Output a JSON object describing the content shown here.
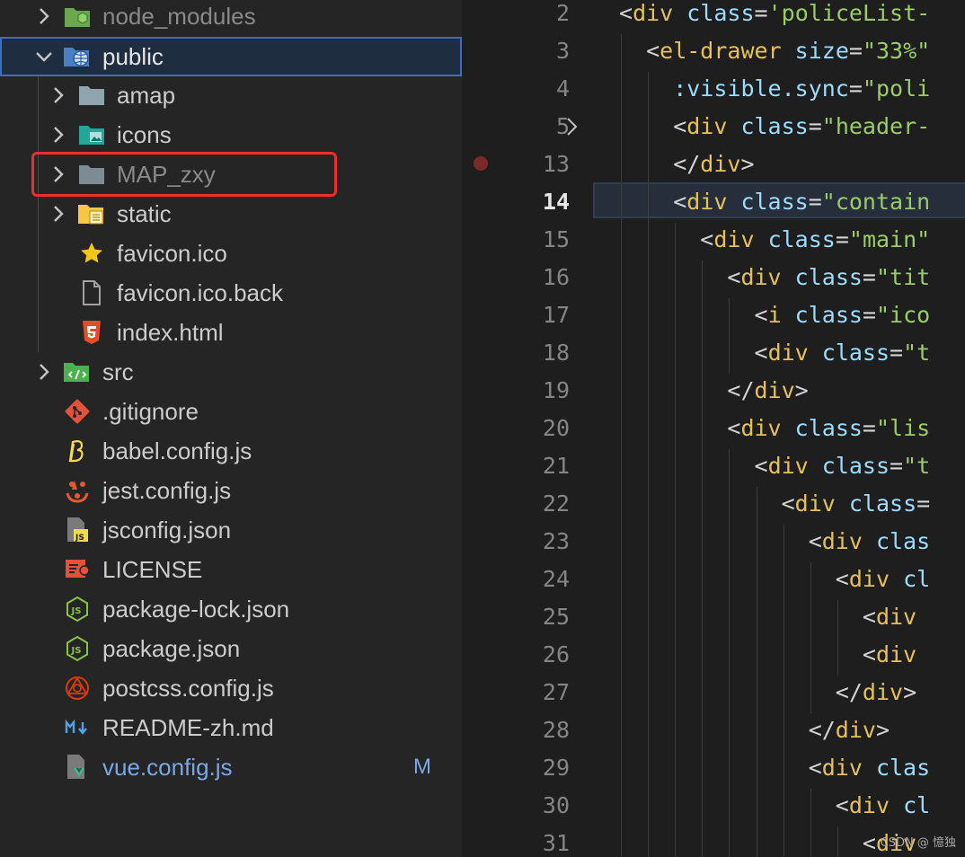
{
  "explorer": {
    "items": [
      {
        "label": "node_modules",
        "icon": "node-modules-folder-icon",
        "expanded": false
      },
      {
        "label": "public",
        "icon": "public-folder-icon",
        "expanded": true,
        "selected": true
      },
      {
        "label": "amap",
        "icon": "folder-icon",
        "expanded": false
      },
      {
        "label": "icons",
        "icon": "images-folder-icon",
        "expanded": false
      },
      {
        "label": "MAP_zxy",
        "icon": "folder-icon",
        "expanded": false,
        "highlighted": true
      },
      {
        "label": "static",
        "icon": "static-folder-icon",
        "expanded": false
      },
      {
        "label": "favicon.ico",
        "icon": "star-icon"
      },
      {
        "label": "favicon.ico.back",
        "icon": "file-icon"
      },
      {
        "label": "index.html",
        "icon": "html5-icon"
      },
      {
        "label": "src",
        "icon": "src-folder-icon",
        "expanded": false
      },
      {
        "label": ".gitignore",
        "icon": "git-icon"
      },
      {
        "label": "babel.config.js",
        "icon": "babel-icon"
      },
      {
        "label": "jest.config.js",
        "icon": "jest-icon"
      },
      {
        "label": "jsconfig.json",
        "icon": "jsconfig-icon"
      },
      {
        "label": "LICENSE",
        "icon": "license-icon"
      },
      {
        "label": "package-lock.json",
        "icon": "nodejs-icon"
      },
      {
        "label": "package.json",
        "icon": "nodejs-icon"
      },
      {
        "label": "postcss.config.js",
        "icon": "postcss-icon"
      },
      {
        "label": "README-zh.md",
        "icon": "markdown-icon"
      },
      {
        "label": "vue.config.js",
        "icon": "vue-config-icon",
        "badge": "M"
      }
    ]
  },
  "editor": {
    "active_line": "14",
    "lines": [
      {
        "n": "2",
        "t": [
          [
            "<",
            "b"
          ],
          [
            "div",
            "tag"
          ],
          [
            " class",
            "attr"
          ],
          [
            "=",
            "p"
          ],
          [
            "'policeList-",
            "str"
          ]
        ]
      },
      {
        "n": "3",
        "t": [
          [
            "<",
            "b"
          ],
          [
            "el-drawer",
            "tag"
          ],
          [
            " size",
            "attr"
          ],
          [
            "=",
            "p"
          ],
          [
            "\"33%\"",
            "str"
          ]
        ]
      },
      {
        "n": "4",
        "t": [
          [
            ":visible.sync",
            "attr"
          ],
          [
            "=",
            "p"
          ],
          [
            "\"poli",
            "str"
          ]
        ]
      },
      {
        "n": "5",
        "t": [
          [
            "<",
            "b"
          ],
          [
            "div",
            "tag"
          ],
          [
            " class",
            "attr"
          ],
          [
            "=",
            "p"
          ],
          [
            "\"header-",
            "str"
          ]
        ]
      },
      {
        "n": "13",
        "t": [
          [
            "</",
            "b"
          ],
          [
            "div",
            "tag"
          ],
          [
            ">",
            "b"
          ]
        ]
      },
      {
        "n": "14",
        "t": [
          [
            "<",
            "b"
          ],
          [
            "div",
            "tag"
          ],
          [
            " class",
            "attr"
          ],
          [
            "=",
            "p"
          ],
          [
            "\"contain",
            "str"
          ]
        ]
      },
      {
        "n": "15",
        "t": [
          [
            "<",
            "b"
          ],
          [
            "div",
            "tag"
          ],
          [
            " class",
            "attr"
          ],
          [
            "=",
            "p"
          ],
          [
            "\"main\"",
            "str"
          ]
        ]
      },
      {
        "n": "16",
        "t": [
          [
            "<",
            "b"
          ],
          [
            "div",
            "tag"
          ],
          [
            " class",
            "attr"
          ],
          [
            "=",
            "p"
          ],
          [
            "\"tit",
            "str"
          ]
        ]
      },
      {
        "n": "17",
        "t": [
          [
            "<",
            "b"
          ],
          [
            "i",
            "tag"
          ],
          [
            " class",
            "attr"
          ],
          [
            "=",
            "p"
          ],
          [
            "\"ico",
            "str"
          ]
        ]
      },
      {
        "n": "18",
        "t": [
          [
            "<",
            "b"
          ],
          [
            "div",
            "tag"
          ],
          [
            " class",
            "attr"
          ],
          [
            "=",
            "p"
          ],
          [
            "\"t",
            "str"
          ]
        ]
      },
      {
        "n": "19",
        "t": [
          [
            "</",
            "b"
          ],
          [
            "div",
            "tag"
          ],
          [
            ">",
            "b"
          ]
        ]
      },
      {
        "n": "20",
        "t": [
          [
            "<",
            "b"
          ],
          [
            "div",
            "tag"
          ],
          [
            " class",
            "attr"
          ],
          [
            "=",
            "p"
          ],
          [
            "\"lis",
            "str"
          ]
        ]
      },
      {
        "n": "21",
        "t": [
          [
            "<",
            "b"
          ],
          [
            "div",
            "tag"
          ],
          [
            " class",
            "attr"
          ],
          [
            "=",
            "p"
          ],
          [
            "\"t",
            "str"
          ]
        ]
      },
      {
        "n": "22",
        "t": [
          [
            "<",
            "b"
          ],
          [
            "div",
            "tag"
          ],
          [
            " class",
            "attr"
          ],
          [
            "=",
            "p"
          ]
        ]
      },
      {
        "n": "23",
        "t": [
          [
            "<",
            "b"
          ],
          [
            "div",
            "tag"
          ],
          [
            " clas",
            "attr"
          ]
        ]
      },
      {
        "n": "24",
        "t": [
          [
            "<",
            "b"
          ],
          [
            "div",
            "tag"
          ],
          [
            " cl",
            "attr"
          ]
        ]
      },
      {
        "n": "25",
        "t": [
          [
            "<",
            "b"
          ],
          [
            "div",
            "tag"
          ]
        ]
      },
      {
        "n": "26",
        "t": [
          [
            "<",
            "b"
          ],
          [
            "div",
            "tag"
          ]
        ]
      },
      {
        "n": "27",
        "t": [
          [
            "</",
            "b"
          ],
          [
            "div",
            "tag"
          ],
          [
            ">",
            "b"
          ]
        ]
      },
      {
        "n": "28",
        "t": [
          [
            "</",
            "b"
          ],
          [
            "div",
            "tag"
          ],
          [
            ">",
            "b"
          ]
        ]
      },
      {
        "n": "29",
        "t": [
          [
            "<",
            "b"
          ],
          [
            "div",
            "tag"
          ],
          [
            " clas",
            "attr"
          ]
        ]
      },
      {
        "n": "30",
        "t": [
          [
            "<",
            "b"
          ],
          [
            "div",
            "tag"
          ],
          [
            " cl",
            "attr"
          ]
        ]
      },
      {
        "n": "31",
        "t": [
          [
            "<",
            "b"
          ],
          [
            "div",
            "tag"
          ]
        ]
      }
    ]
  },
  "watermark": "CSDN @ 憶独"
}
